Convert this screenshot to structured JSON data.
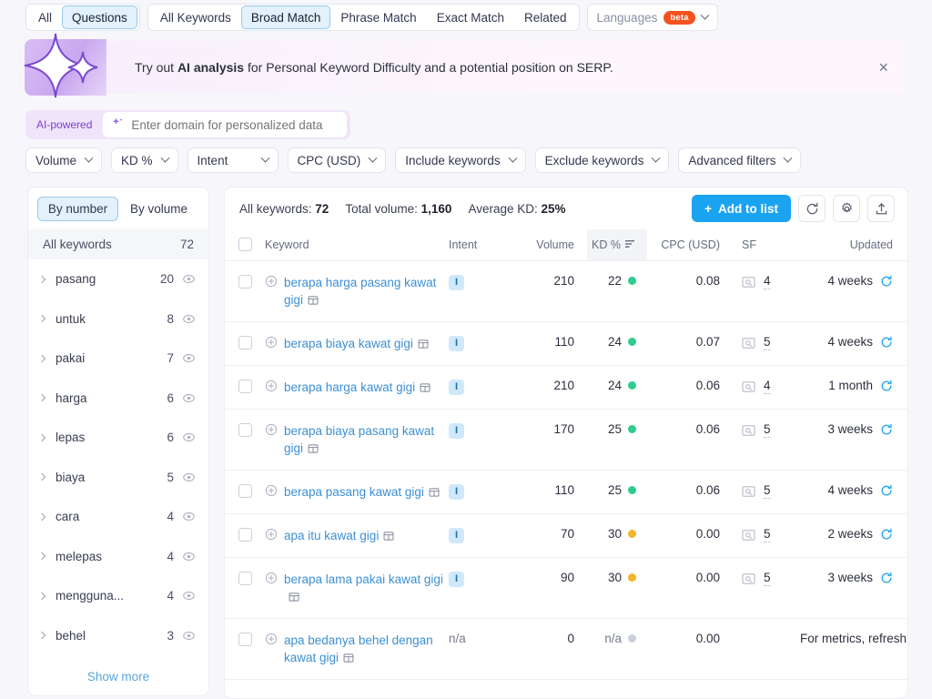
{
  "tabs": {
    "group1": [
      {
        "label": "All",
        "active": false
      },
      {
        "label": "Questions",
        "active": true
      }
    ],
    "group2": [
      {
        "label": "All Keywords",
        "active": false
      },
      {
        "label": "Broad Match",
        "active": true
      },
      {
        "label": "Phrase Match",
        "active": false
      },
      {
        "label": "Exact Match",
        "active": false
      },
      {
        "label": "Related",
        "active": false
      }
    ],
    "languages": {
      "label": "Languages",
      "badge": "beta"
    }
  },
  "banner": {
    "text_lead": "Try out ",
    "text_bold": "AI analysis",
    "text_rest": " for Personal Keyword Difficulty and a potential position on SERP.",
    "close": "×"
  },
  "ai_row": {
    "tag": "AI-powered",
    "placeholder": "Enter domain for personalized data",
    "value": ""
  },
  "filters": [
    {
      "label": "Volume"
    },
    {
      "label": "KD %"
    },
    {
      "label": "Intent"
    },
    {
      "label": "CPC (USD)"
    },
    {
      "label": "Include keywords"
    },
    {
      "label": "Exclude keywords"
    },
    {
      "label": "Advanced filters"
    }
  ],
  "sidebar": {
    "segments": [
      {
        "label": "By number",
        "active": true
      },
      {
        "label": "By volume",
        "active": false
      }
    ],
    "all_label": "All keywords",
    "all_count": "72",
    "groups": [
      {
        "name": "pasang",
        "count": "20"
      },
      {
        "name": "untuk",
        "count": "8"
      },
      {
        "name": "pakai",
        "count": "7"
      },
      {
        "name": "harga",
        "count": "6"
      },
      {
        "name": "lepas",
        "count": "6"
      },
      {
        "name": "biaya",
        "count": "5"
      },
      {
        "name": "cara",
        "count": "4"
      },
      {
        "name": "melepas",
        "count": "4"
      },
      {
        "name": "mengguna...",
        "count": "4"
      },
      {
        "name": "behel",
        "count": "3"
      }
    ],
    "show_more": "Show more"
  },
  "panel": {
    "stats": {
      "all_keywords_label": "All keywords:",
      "all_keywords_value": "72",
      "total_volume_label": "Total volume:",
      "total_volume_value": "1,160",
      "average_kd_label": "Average KD:",
      "average_kd_value": "25%"
    },
    "add_to_list": "Add to list",
    "add_plus": "+",
    "columns": {
      "keyword": "Keyword",
      "intent": "Intent",
      "volume": "Volume",
      "kd": "KD %",
      "cpc": "CPC (USD)",
      "sf": "SF",
      "updated": "Updated"
    },
    "rows": [
      {
        "keyword": "berapa harga pasang kawat gigi",
        "intent": "I",
        "volume": "210",
        "kd": "22",
        "kd_color": "#2ecc8f",
        "cpc": "0.08",
        "sf": "4",
        "updated": "4 weeks",
        "has_sf": true
      },
      {
        "keyword": "berapa biaya kawat gigi",
        "intent": "I",
        "volume": "110",
        "kd": "24",
        "kd_color": "#2ecc8f",
        "cpc": "0.07",
        "sf": "5",
        "updated": "4 weeks",
        "has_sf": true
      },
      {
        "keyword": "berapa harga kawat gigi",
        "intent": "I",
        "volume": "210",
        "kd": "24",
        "kd_color": "#2ecc8f",
        "cpc": "0.06",
        "sf": "4",
        "updated": "1 month",
        "has_sf": true
      },
      {
        "keyword": "berapa biaya pasang kawat gigi",
        "intent": "I",
        "volume": "170",
        "kd": "25",
        "kd_color": "#2ecc8f",
        "cpc": "0.06",
        "sf": "5",
        "updated": "3 weeks",
        "has_sf": true
      },
      {
        "keyword": "berapa pasang kawat gigi",
        "intent": "I",
        "volume": "110",
        "kd": "25",
        "kd_color": "#2ecc8f",
        "cpc": "0.06",
        "sf": "5",
        "updated": "4 weeks",
        "has_sf": true
      },
      {
        "keyword": "apa itu kawat gigi",
        "intent": "I",
        "volume": "70",
        "kd": "30",
        "kd_color": "#f5b429",
        "cpc": "0.00",
        "sf": "5",
        "updated": "2 weeks",
        "has_sf": true
      },
      {
        "keyword": "berapa lama pakai kawat gigi",
        "intent": "I",
        "volume": "90",
        "kd": "30",
        "kd_color": "#f5b429",
        "cpc": "0.00",
        "sf": "5",
        "updated": "3 weeks",
        "has_sf": true
      },
      {
        "keyword": "apa bedanya behel dengan kawat gigi",
        "intent": "n/a",
        "volume": "0",
        "kd": "n/a",
        "kd_color": "#ccd0dc",
        "cpc": "0.00",
        "sf": "",
        "updated": "For metrics, refresh",
        "has_sf": false
      }
    ]
  }
}
